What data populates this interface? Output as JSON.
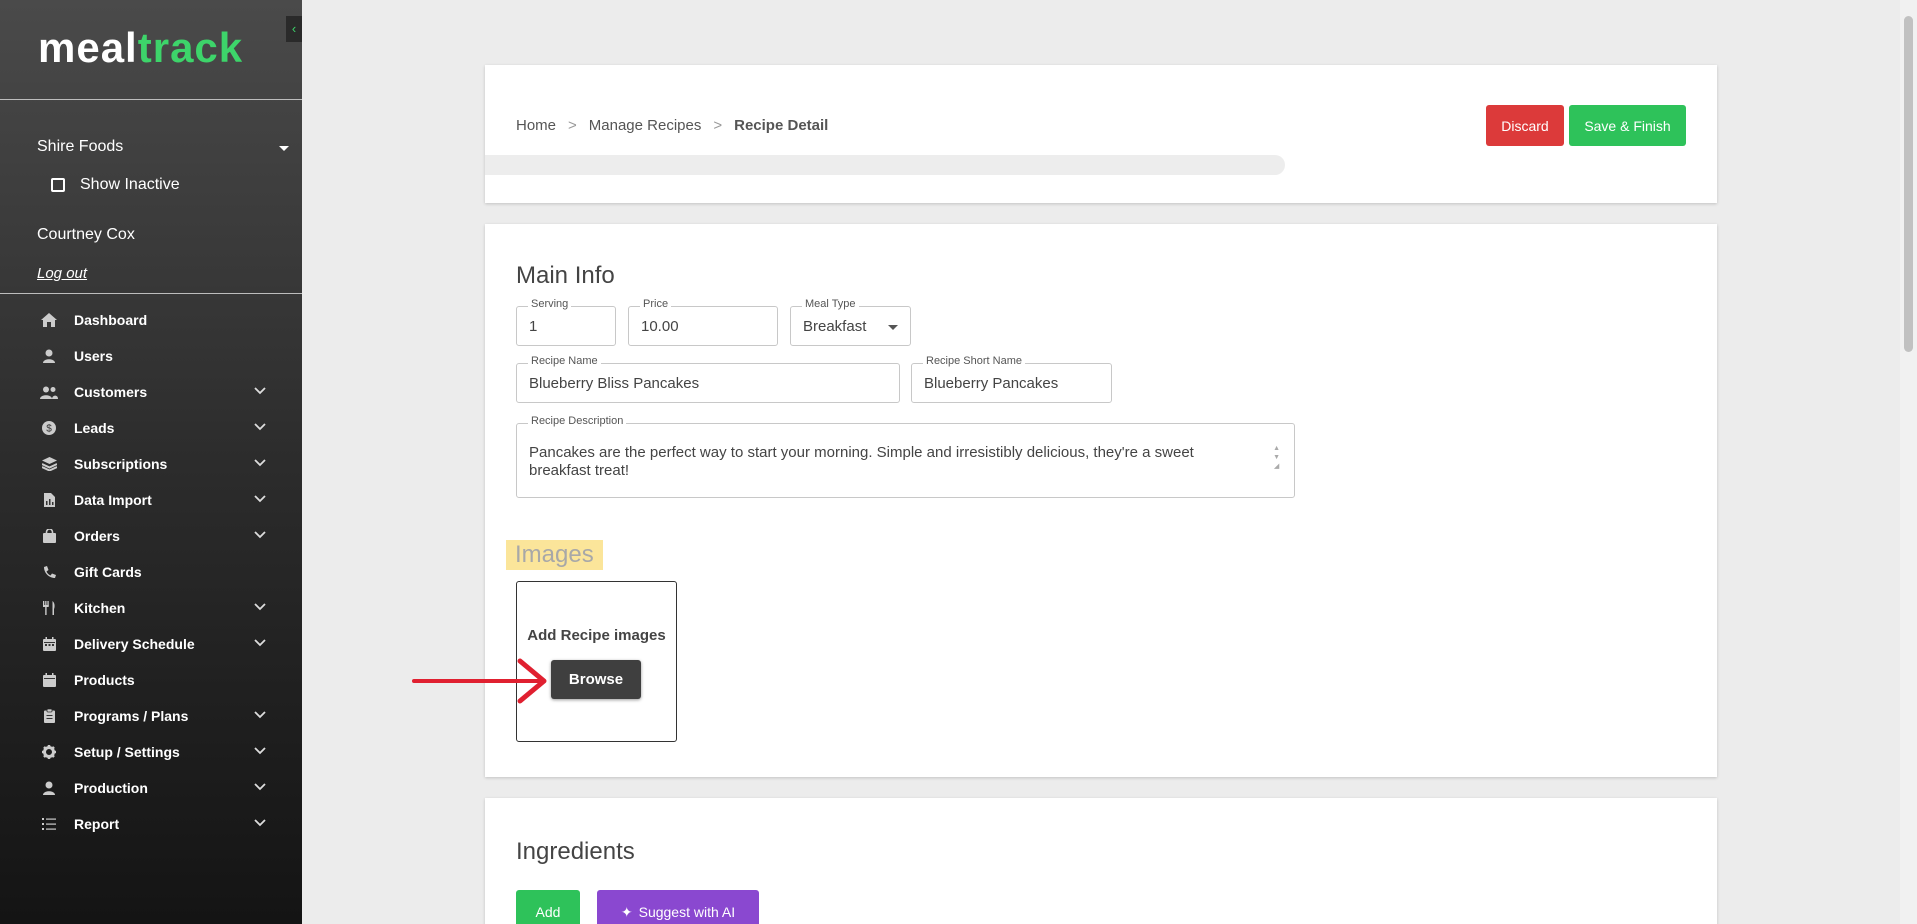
{
  "app": {
    "logo_part1": "meal",
    "logo_part2": "track",
    "collapse_icon": "chevron-left-icon",
    "brand_green": "#3dd46a"
  },
  "sidebar": {
    "company": "Shire Foods",
    "show_inactive_label": "Show Inactive",
    "show_inactive_checked": false,
    "user_name": "Courtney Cox",
    "logout_label": "Log out",
    "items": [
      {
        "label": "Dashboard",
        "icon": "home-icon",
        "expandable": false
      },
      {
        "label": "Users",
        "icon": "user-icon",
        "expandable": false
      },
      {
        "label": "Customers",
        "icon": "users-icon",
        "expandable": true
      },
      {
        "label": "Leads",
        "icon": "dollar-coin-icon",
        "expandable": true
      },
      {
        "label": "Subscriptions",
        "icon": "layers-icon",
        "expandable": true
      },
      {
        "label": "Data Import",
        "icon": "file-chart-icon",
        "expandable": true
      },
      {
        "label": "Orders",
        "icon": "shopping-bag-icon",
        "expandable": true
      },
      {
        "label": "Gift Cards",
        "icon": "phone-icon",
        "expandable": false
      },
      {
        "label": "Kitchen",
        "icon": "utensils-icon",
        "expandable": true
      },
      {
        "label": "Delivery Schedule",
        "icon": "calendar-icon",
        "expandable": true
      },
      {
        "label": "Products",
        "icon": "calendar-icon",
        "expandable": false
      },
      {
        "label": "Programs / Plans",
        "icon": "clipboard-icon",
        "expandable": true
      },
      {
        "label": "Setup / Settings",
        "icon": "gear-icon",
        "expandable": true
      },
      {
        "label": "Production",
        "icon": "user-icon",
        "expandable": true
      },
      {
        "label": "Report",
        "icon": "list-icon",
        "expandable": true
      }
    ]
  },
  "header": {
    "breadcrumb": [
      "Home",
      "Manage Recipes",
      "Recipe Detail"
    ],
    "breadcrumb_separator": ">",
    "discard_label": "Discard",
    "save_label": "Save & Finish",
    "discard_color": "#dc3a3a",
    "save_color": "#2ec25a"
  },
  "main_info": {
    "title": "Main Info",
    "serving_label": "Serving",
    "serving_value": "1",
    "price_label": "Price",
    "price_value": "10.00",
    "meal_type_label": "Meal Type",
    "meal_type_value": "Breakfast",
    "recipe_name_label": "Recipe Name",
    "recipe_name_value": "Blueberry Bliss Pancakes",
    "recipe_short_name_label": "Recipe Short Name",
    "recipe_short_name_value": "Blueberry Pancakes",
    "recipe_description_label": "Recipe Description",
    "recipe_description_value": "Pancakes are the perfect way to start your morning. Simple and irresistibly delicious, they're a sweet breakfast treat!"
  },
  "images": {
    "title": "Images",
    "add_label": "Add Recipe images",
    "browse_label": "Browse",
    "highlight_color": "#fbe59a"
  },
  "ingredients": {
    "title": "Ingredients",
    "add_label": "Add",
    "suggest_label": "Suggest with AI",
    "suggest_icon": "sparkle-icon",
    "suggest_color": "#8a48d0"
  },
  "annotation": {
    "arrow_color": "#e02030"
  }
}
